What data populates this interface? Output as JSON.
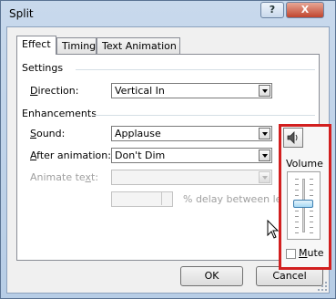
{
  "window": {
    "title": "Split",
    "help_label": "?",
    "close_label": "X"
  },
  "tabs": [
    {
      "label": "Effect"
    },
    {
      "label": "Timing"
    },
    {
      "label": "Text Animation"
    }
  ],
  "settings": {
    "heading": "Settings",
    "direction_label_accel": "D",
    "direction_label_rest": "irection:",
    "direction_value": "Vertical In"
  },
  "enhancements": {
    "heading": "Enhancements",
    "sound_label_accel": "S",
    "sound_label_rest": "ound:",
    "sound_value": "Applause",
    "after_label_accel": "A",
    "after_label_rest": "fter animation:",
    "after_value": "Don't Dim",
    "animate_text_label": "Animate te",
    "animate_text_accel": "x",
    "animate_text_rest": "t:",
    "animate_text_value": "",
    "delay_value": "",
    "delay_label": "% delay between lette"
  },
  "volume_popup": {
    "label": "Volume",
    "mute_accel": "M",
    "mute_rest": "ute",
    "mute_checked": false,
    "level_fraction": 0.55
  },
  "buttons": {
    "ok": "OK",
    "cancel": "Cancel"
  },
  "colors": {
    "highlight_border": "#d21f1f",
    "thumb": "#a7d9f5"
  },
  "icons": {
    "speaker": "speaker-icon"
  }
}
